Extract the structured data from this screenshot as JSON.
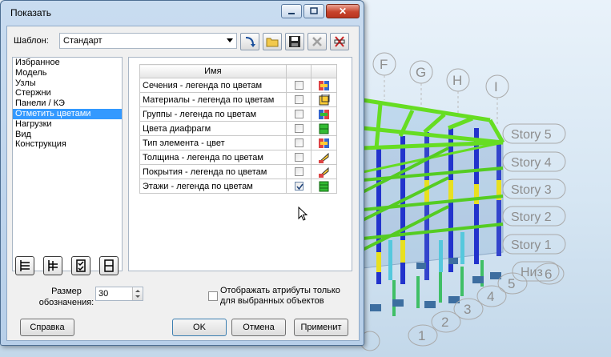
{
  "dialog": {
    "title": "Показать",
    "close_glyph": "✕",
    "template_label": "Шаблон:",
    "template_value": "Стандарт",
    "toolbar": [
      {
        "icon": "apply-template-icon"
      },
      {
        "icon": "open-folder-icon"
      },
      {
        "icon": "save-disk-icon"
      },
      {
        "icon": "delete-icon"
      },
      {
        "icon": "cut-icon"
      }
    ],
    "tree_items": [
      "Избранное",
      "Модель",
      "Узлы",
      "Стержни",
      "Панели / КЭ",
      "Отметить цветами",
      "Нагрузки",
      "Вид",
      "Конструкция"
    ],
    "selected_tree_item": "Отметить цветами",
    "grid": {
      "header": "Имя",
      "rows": [
        {
          "name": "Сечения - легенда по цветам",
          "checked": false,
          "icon": "sections-legend-icon"
        },
        {
          "name": "Материалы - легенда по цветам",
          "checked": false,
          "icon": "materials-legend-icon"
        },
        {
          "name": "Группы - легенда по цветам",
          "checked": false,
          "icon": "groups-legend-icon"
        },
        {
          "name": "Цвета диафрагм",
          "checked": false,
          "icon": "diaphragm-colors-icon"
        },
        {
          "name": "Тип элемента - цвет",
          "checked": false,
          "icon": "element-type-icon"
        },
        {
          "name": "Толщина - легенда по цветам",
          "checked": false,
          "icon": "thickness-legend-icon"
        },
        {
          "name": "Покрытия - легенда по цветам",
          "checked": false,
          "icon": "coverings-legend-icon"
        },
        {
          "name": "Этажи - легенда по цветам",
          "checked": true,
          "icon": "stories-legend-icon"
        }
      ]
    },
    "size_label": "Размер обозначения:",
    "size_value": "30",
    "attr_label": "Отображать атрибуты только для выбранных объектов",
    "buttons": {
      "help": "Справка",
      "ok": "OK",
      "cancel": "Отмена",
      "apply": "Применит"
    }
  },
  "viewport": {
    "grid_letters": [
      "F",
      "G",
      "H",
      "I"
    ],
    "stories": [
      "Story 5",
      "Story 4",
      "Story 3",
      "Story 2",
      "Story 1",
      "Низ"
    ],
    "grid_numbers": [
      "1",
      "2",
      "3",
      "4",
      "5",
      "6"
    ],
    "colors": {
      "beams_top": "#66dd22",
      "columns": "#2233cc",
      "columns_highlight": "#e8e020",
      "supports": "#3d6ea0",
      "bubbles": "#9a9a9a"
    }
  }
}
